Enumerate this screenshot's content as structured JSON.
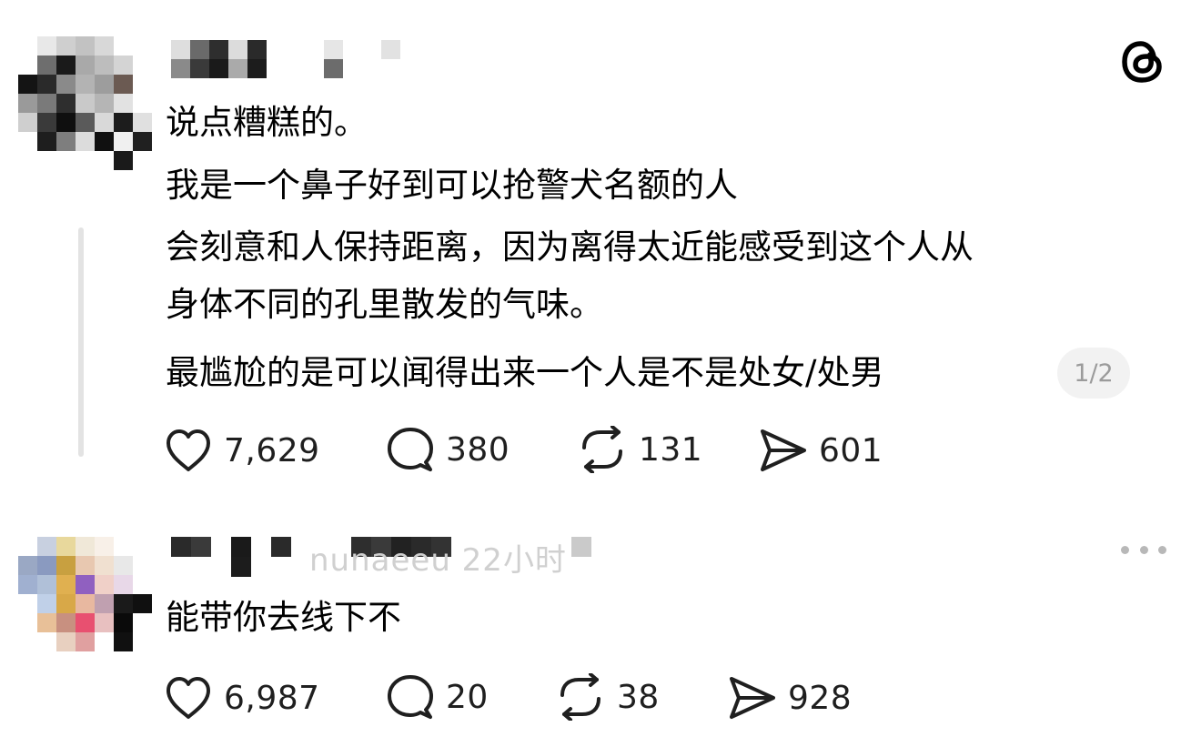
{
  "app": {
    "logo_icon": "threads-logo-icon"
  },
  "post": {
    "author_hidden": true,
    "lines": [
      "说点糟糕的。",
      "我是一个鼻子好到可以抢警犬名额的人",
      "会刻意和人保持距离，因为离得太近能感受到这个人从",
      "身体不同的孔里散发的气味。",
      "最尴尬的是可以闻得出来一个人是不是处女/处男"
    ],
    "page_indicator": "1/2",
    "actions": {
      "likes": "7,629",
      "replies": "380",
      "reposts": "131",
      "shares": "601"
    }
  },
  "reply": {
    "author_fragment": "nunaeeu  22小时",
    "text": "能带你去线下不",
    "actions": {
      "likes": "6,987",
      "replies": "20",
      "reposts": "38",
      "shares": "928"
    },
    "more_icon": "more-horizontal-icon"
  },
  "colors": {
    "text": "#000000",
    "icon": "#1f1f1f",
    "muted": "#9b9b9b",
    "thread_line": "#e3e3e3",
    "badge_bg": "#f2f2f2"
  }
}
